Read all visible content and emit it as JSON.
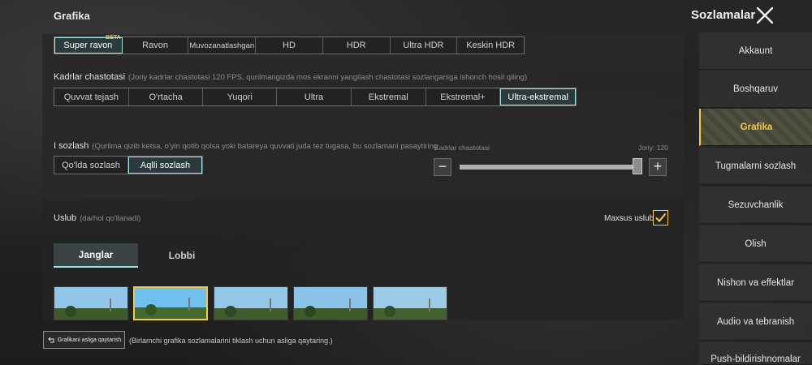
{
  "header": {
    "page_title": "Grafika",
    "settings_title": "Sozlamalar"
  },
  "quality": {
    "options": [
      {
        "label": "Super ravon",
        "badge": "BETA",
        "active": true
      },
      {
        "label": "Ravon"
      },
      {
        "label": "Muvozanatlashgan"
      },
      {
        "label": "HD"
      },
      {
        "label": "HDR"
      },
      {
        "label": "Ultra HDR"
      },
      {
        "label": "Keskin HDR"
      }
    ]
  },
  "frame_rate": {
    "label": "Kadrlar chastotasi",
    "hint": "(Joriy kadrlar chastotasi 120 FPS, qurilmangizda mos ekranni yangilash chastotasi sozlanganiga ishonch hosil qiling)",
    "options": [
      {
        "label": "Quvvat tejash"
      },
      {
        "label": "O'rtacha"
      },
      {
        "label": "Yuqori"
      },
      {
        "label": "Ultra"
      },
      {
        "label": "Ekstremal"
      },
      {
        "label": "Ekstremal+"
      },
      {
        "label": "Ultra-ekstremal",
        "active": true
      }
    ]
  },
  "i_settings": {
    "label": "I sozlash",
    "hint": "(Qurilma qizib ketsa, o'yin qotib qolsa yoki batareya quvvati juda tez tugasa, bu sozlamani pasaytiring",
    "options": [
      {
        "label": "Qo'lda sozlash"
      },
      {
        "label": "Aqlli sozlash",
        "active": true
      }
    ]
  },
  "slider": {
    "label": "Kadrlar chastotasi",
    "current": "Joriy: 120",
    "value_fraction": 0.97,
    "minus": "−",
    "plus": "+"
  },
  "style": {
    "label": "Uslub",
    "hint": "(darhol qo'llanadi)",
    "custom_label": "Maxsus uslub",
    "custom_checked": true,
    "tabs": [
      {
        "label": "Janglar",
        "active": true
      },
      {
        "label": "Lobbi"
      }
    ],
    "selected_thumbnail": 1
  },
  "reset": {
    "button_label": "Grafikani asliga qaytarish",
    "hint": "(Birlamchi grafika sozlamalarini tiklash uchun asliga qaytaring.)"
  },
  "sidebar": {
    "items": [
      {
        "label": "Akkaunt"
      },
      {
        "label": "Boshqaruv"
      },
      {
        "label": "Grafika",
        "active": true
      },
      {
        "label": "Tugmalarni sozlash"
      },
      {
        "label": "Sezuvchanlik"
      },
      {
        "label": "Olish"
      },
      {
        "label": "Nishon va effektlar"
      },
      {
        "label": "Audio va tebranish"
      },
      {
        "label": "Push-bildirishnomalar"
      }
    ]
  },
  "colors": {
    "accent_cyan": "#9fe3e6",
    "accent_yellow": "#f2c94c"
  }
}
